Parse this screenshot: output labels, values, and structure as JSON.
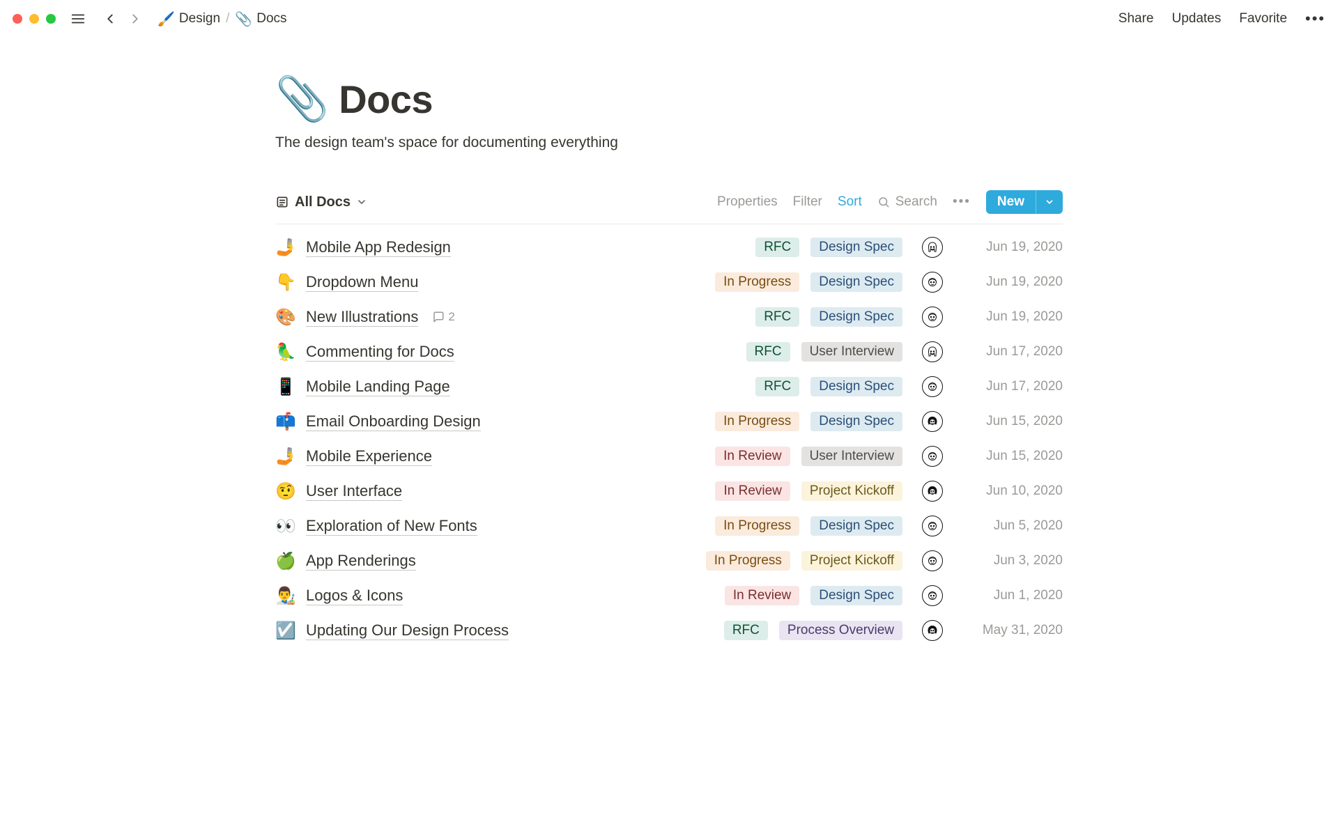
{
  "topbar": {
    "breadcrumbs": [
      {
        "emoji": "🖌️",
        "label": "Design"
      },
      {
        "emoji": "📎",
        "label": "Docs"
      }
    ],
    "actions": {
      "share": "Share",
      "updates": "Updates",
      "favorite": "Favorite"
    }
  },
  "page": {
    "emoji": "📎",
    "title": "Docs",
    "subtitle": "The design team's space for documenting everything"
  },
  "view": {
    "name": "All Docs",
    "controls": {
      "properties": "Properties",
      "filter": "Filter",
      "sort": "Sort",
      "search": "Search",
      "new": "New"
    }
  },
  "tag_colors": {
    "RFC": "green",
    "Design Spec": "blue",
    "In Progress": "orange",
    "User Interview": "gray",
    "In Review": "red",
    "Project Kickoff": "yellow",
    "Process Overview": "purple"
  },
  "rows": [
    {
      "emoji": "🤳",
      "title": "Mobile App Redesign",
      "tags": [
        "RFC",
        "Design Spec"
      ],
      "date": "Jun 19, 2020",
      "avatar": 0
    },
    {
      "emoji": "👇",
      "title": "Dropdown Menu",
      "tags": [
        "In Progress",
        "Design Spec"
      ],
      "date": "Jun 19, 2020",
      "avatar": 1
    },
    {
      "emoji": "🎨",
      "title": "New Illustrations",
      "tags": [
        "RFC",
        "Design Spec"
      ],
      "date": "Jun 19, 2020",
      "avatar": 1,
      "comments": 2
    },
    {
      "emoji": "🦜",
      "title": "Commenting for Docs",
      "tags": [
        "RFC",
        "User Interview"
      ],
      "date": "Jun 17, 2020",
      "avatar": 0
    },
    {
      "emoji": "📱",
      "title": "Mobile Landing Page",
      "tags": [
        "RFC",
        "Design Spec"
      ],
      "date": "Jun 17, 2020",
      "avatar": 1
    },
    {
      "emoji": "📫",
      "title": "Email Onboarding Design",
      "tags": [
        "In Progress",
        "Design Spec"
      ],
      "date": "Jun 15, 2020",
      "avatar": 2
    },
    {
      "emoji": "🤳",
      "title": "Mobile Experience",
      "tags": [
        "In Review",
        "User Interview"
      ],
      "date": "Jun 15, 2020",
      "avatar": 1
    },
    {
      "emoji": "🤨",
      "title": "User Interface",
      "tags": [
        "In Review",
        "Project Kickoff"
      ],
      "date": "Jun 10, 2020",
      "avatar": 2
    },
    {
      "emoji": "👀",
      "title": "Exploration of New Fonts",
      "tags": [
        "In Progress",
        "Design Spec"
      ],
      "date": "Jun 5, 2020",
      "avatar": 1
    },
    {
      "emoji": "🍏",
      "title": "App Renderings",
      "tags": [
        "In Progress",
        "Project Kickoff"
      ],
      "date": "Jun 3, 2020",
      "avatar": 1
    },
    {
      "emoji": "👨‍🎨",
      "title": "Logos & Icons",
      "tags": [
        "In Review",
        "Design Spec"
      ],
      "date": "Jun 1, 2020",
      "avatar": 1
    },
    {
      "emoji": "☑️",
      "title": "Updating Our Design Process",
      "tags": [
        "RFC",
        "Process Overview"
      ],
      "date": "May 31, 2020",
      "avatar": 2
    }
  ]
}
